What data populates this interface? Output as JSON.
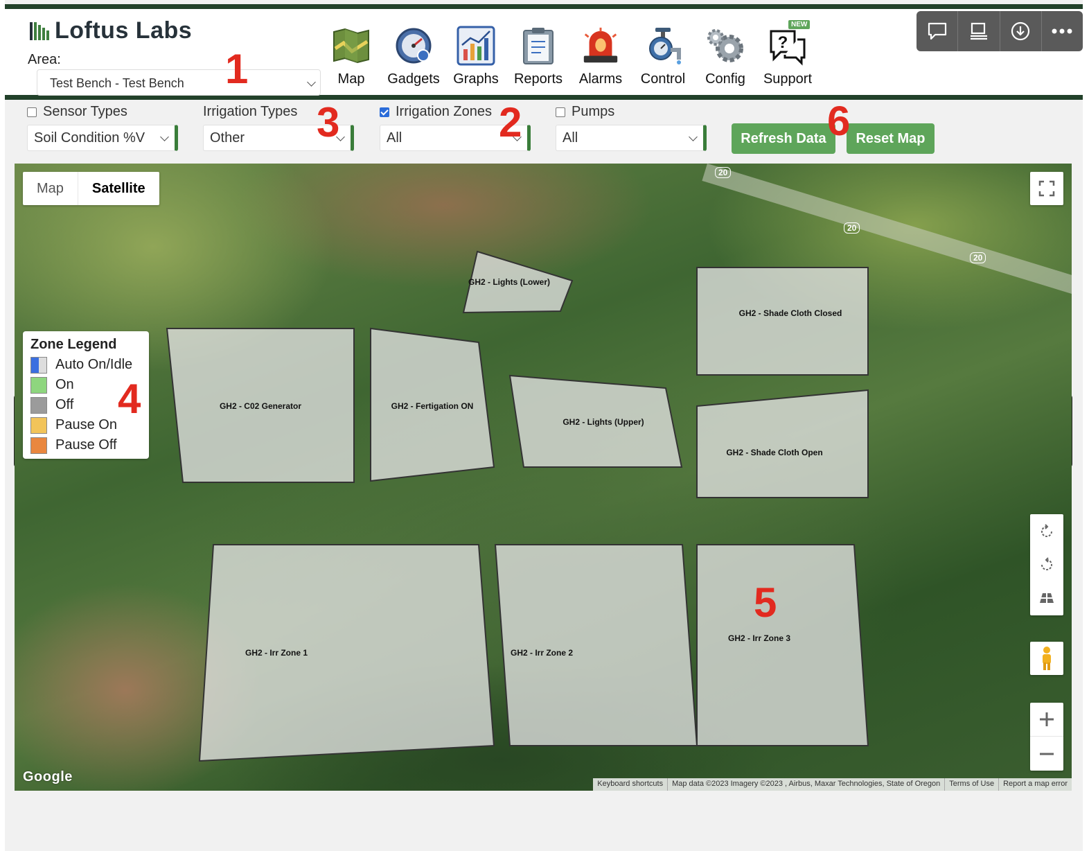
{
  "header": {
    "logo_text": "Loftus Labs",
    "area_label": "Area:",
    "area_value": "Test Bench - Test Bench"
  },
  "nav": [
    {
      "label": "Map",
      "icon": "map-icon"
    },
    {
      "label": "Gadgets",
      "icon": "gauge-icon"
    },
    {
      "label": "Graphs",
      "icon": "graph-icon"
    },
    {
      "label": "Reports",
      "icon": "clipboard-icon"
    },
    {
      "label": "Alarms",
      "icon": "siren-icon"
    },
    {
      "label": "Control",
      "icon": "valve-icon"
    },
    {
      "label": "Config",
      "icon": "gears-icon"
    },
    {
      "label": "Support",
      "icon": "help-chat-icon",
      "badge": "NEW"
    }
  ],
  "toolbar": [
    "comment-icon",
    "present-icon",
    "download-icon",
    "more-icon"
  ],
  "filters": {
    "sensor_types": {
      "label": "Sensor Types",
      "checked": false,
      "value": "Soil Condition %V"
    },
    "irrigation_types": {
      "label": "Irrigation Types",
      "value": "Other"
    },
    "irrigation_zones": {
      "label": "Irrigation Zones",
      "checked": true,
      "value": "All"
    },
    "pumps": {
      "label": "Pumps",
      "checked": false,
      "value": "All"
    }
  },
  "buttons": {
    "refresh": "Refresh Data",
    "reset": "Reset Map"
  },
  "map": {
    "type_map": "Map",
    "type_satellite": "Satellite",
    "road_labels": [
      "20",
      "20",
      "20"
    ],
    "google_logo": "Google",
    "attribution": [
      "Keyboard shortcuts",
      "Map data ©2023 Imagery ©2023 , Airbus, Maxar Technologies, State of Oregon",
      "Terms of Use",
      "Report a map error"
    ]
  },
  "legend": {
    "title": "Zone Legend",
    "items": [
      {
        "label": "Auto On/Idle",
        "color": "#3b6fe0",
        "color2": "#dddddd"
      },
      {
        "label": "On",
        "color": "#8ed67e"
      },
      {
        "label": "Off",
        "color": "#9b9b9b"
      },
      {
        "label": "Pause On",
        "color": "#f2c45a"
      },
      {
        "label": "Pause Off",
        "color": "#e9873f"
      }
    ]
  },
  "zones": [
    "GH2 - Lights (Lower)",
    "GH2 - Shade Cloth Closed",
    "GH2 - C02 Generator",
    "GH2 - Fertigation ON",
    "GH2 - Lights (Upper)",
    "GH2 - Shade Cloth Open",
    "GH2 - Irr Zone 1",
    "GH2 - Irr Zone 2",
    "GH2 - Irr Zone 3"
  ],
  "annotations": [
    "1",
    "2",
    "3",
    "4",
    "5",
    "6"
  ]
}
